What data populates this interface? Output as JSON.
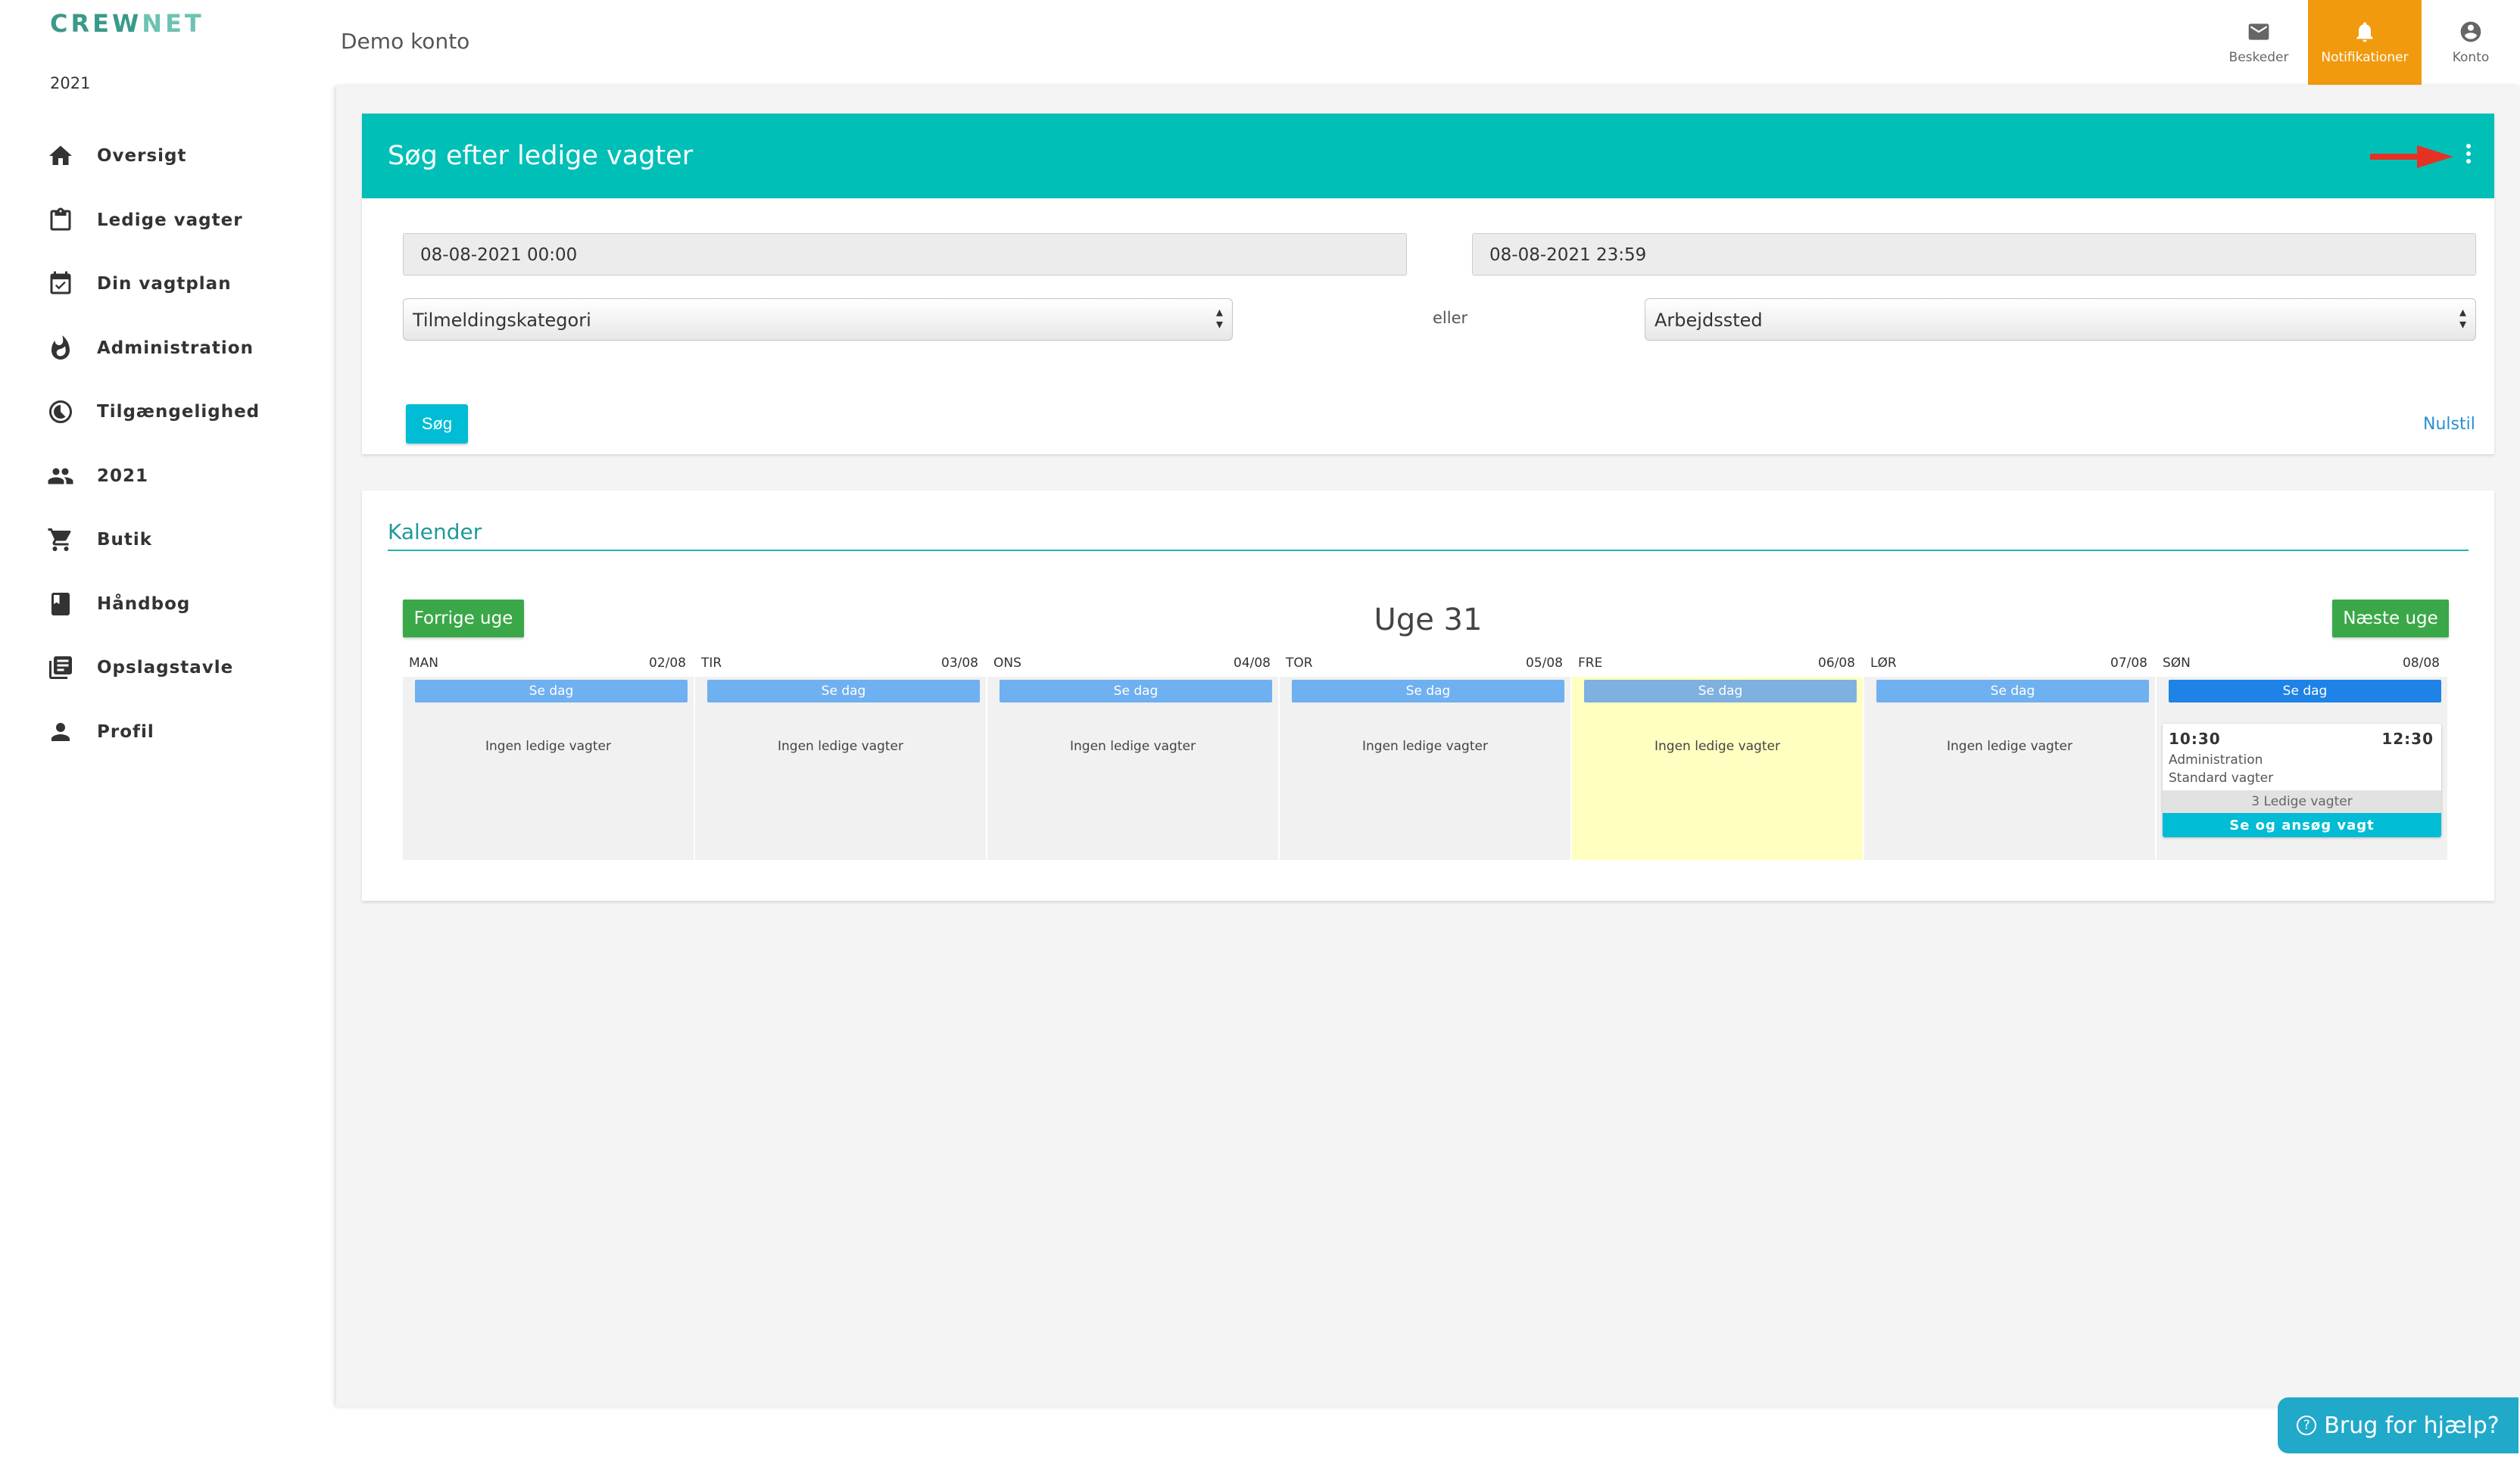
{
  "brand": {
    "part1": "CREW",
    "part2": "NET"
  },
  "sidebar": {
    "year": "2021",
    "items": [
      {
        "label": "Oversigt",
        "icon": "home-icon"
      },
      {
        "label": "Ledige vagter",
        "icon": "clipboard-icon"
      },
      {
        "label": "Din vagtplan",
        "icon": "calendar-check-icon"
      },
      {
        "label": "Administration",
        "icon": "flame-icon"
      },
      {
        "label": "Tilgængelighed",
        "icon": "availability-icon"
      },
      {
        "label": "2021",
        "icon": "people-icon"
      },
      {
        "label": "Butik",
        "icon": "cart-icon"
      },
      {
        "label": "Håndbog",
        "icon": "book-icon"
      },
      {
        "label": "Opslagstavle",
        "icon": "board-icon"
      },
      {
        "label": "Profil",
        "icon": "person-icon"
      }
    ]
  },
  "header": {
    "account": "Demo konto",
    "actions": {
      "messages": "Beskeder",
      "notifications": "Notifikationer",
      "account": "Konto"
    },
    "accent": "#f29a0e"
  },
  "search": {
    "title": "Søg efter ledige vagter",
    "from_date": "08-08-2021 00:00",
    "to_date": "08-08-2021 23:59",
    "category_select": "Tilmeldingskategori",
    "or_text": "eller",
    "workplace_select": "Arbejdssted",
    "search_button": "Søg",
    "reset_link": "Nulstil",
    "header_color": "#00bfb7"
  },
  "calendar": {
    "title": "Kalender",
    "prev_button": "Forrige uge",
    "next_button": "Næste uge",
    "week_label": "Uge 31",
    "see_day_label": "Se dag",
    "empty_text": "Ingen ledige vagter",
    "days": [
      {
        "name": "MAN",
        "date": "02/08"
      },
      {
        "name": "TIR",
        "date": "03/08"
      },
      {
        "name": "ONS",
        "date": "04/08"
      },
      {
        "name": "TOR",
        "date": "05/08"
      },
      {
        "name": "FRE",
        "date": "06/08"
      },
      {
        "name": "LØR",
        "date": "07/08"
      },
      {
        "name": "SØN",
        "date": "08/08"
      }
    ],
    "shift": {
      "start": "10:30",
      "end": "12:30",
      "line1": "Administration",
      "line2": "Standard vagter",
      "count": "3 Ledige vagter",
      "apply": "Se og ansøg vagt"
    }
  },
  "help": {
    "label": "Brug for hjælp?"
  }
}
